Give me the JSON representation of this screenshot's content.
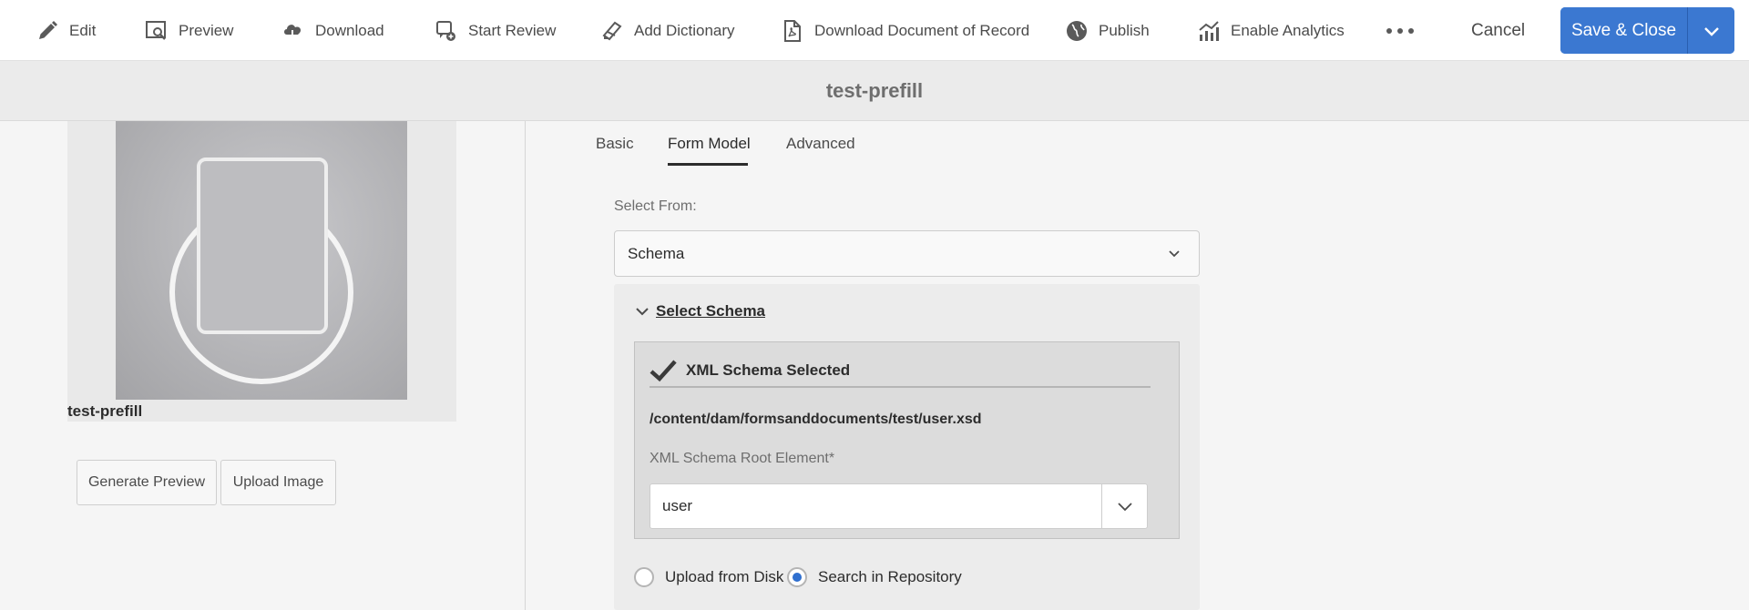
{
  "toolbar": {
    "items": [
      {
        "label": "Edit",
        "icon": "pencil-icon"
      },
      {
        "label": "Preview",
        "icon": "preview-icon"
      },
      {
        "label": "Download",
        "icon": "cloud-download-icon"
      },
      {
        "label": "Start Review",
        "icon": "review-icon"
      },
      {
        "label": "Add Dictionary",
        "icon": "dictionary-icon"
      },
      {
        "label": "Download Document of Record",
        "icon": "pdf-document-icon"
      },
      {
        "label": "Publish",
        "icon": "globe-icon"
      },
      {
        "label": "Enable Analytics",
        "icon": "analytics-icon"
      }
    ],
    "more_icon": "more-icon",
    "cancel_label": "Cancel",
    "save_label": "Save & Close"
  },
  "title": "test-prefill",
  "thumbnail": {
    "label": "test-prefill",
    "generate_preview_label": "Generate Preview",
    "upload_image_label": "Upload Image"
  },
  "tabs": [
    {
      "label": "Basic",
      "active": false
    },
    {
      "label": "Form Model",
      "active": true
    },
    {
      "label": "Advanced",
      "active": false
    }
  ],
  "form_model": {
    "select_from_label": "Select From:",
    "select_from_value": "Schema",
    "select_schema_title": "Select Schema",
    "selected_title": "XML Schema Selected",
    "schema_path": "/content/dam/formsanddocuments/test/user.xsd",
    "root_element_label": "XML Schema Root Element*",
    "root_element_value": "user",
    "radio_upload_label": "Upload from Disk",
    "radio_search_label": "Search in Repository",
    "radio_selected": "Search in Repository"
  },
  "colors": {
    "accent": "#3b78d1",
    "radio_selected": "#2f6fcf"
  }
}
